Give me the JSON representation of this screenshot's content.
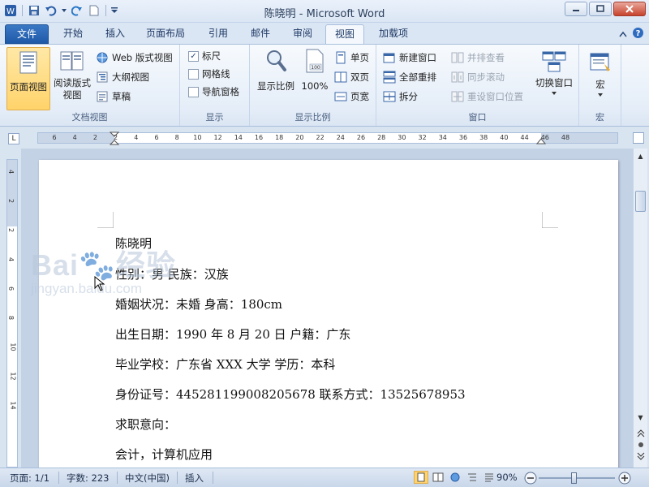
{
  "window": {
    "title": "陈晓明 - Microsoft Word",
    "app_icon": "W"
  },
  "tabs": [
    {
      "label": "文件"
    },
    {
      "label": "开始"
    },
    {
      "label": "插入"
    },
    {
      "label": "页面布局"
    },
    {
      "label": "引用"
    },
    {
      "label": "邮件"
    },
    {
      "label": "审阅"
    },
    {
      "label": "视图"
    },
    {
      "label": "加载项"
    }
  ],
  "ribbon": {
    "doc_views": {
      "label": "文档视图",
      "print_layout": "页面视图",
      "reading_layout_1": "阅读版式",
      "reading_layout_2": "视图",
      "web_layout": "Web 版式视图",
      "outline": "大纲视图",
      "draft": "草稿"
    },
    "show": {
      "label": "显示",
      "ruler": "标尺",
      "gridlines": "网格线",
      "nav_pane": "导航窗格"
    },
    "zoom": {
      "label": "显示比例",
      "zoom": "显示比例",
      "hundred": "100%",
      "one_page": "单页",
      "two_pages": "双页",
      "page_width": "页宽"
    },
    "window": {
      "label": "窗口",
      "new_window": "新建窗口",
      "arrange_all": "全部重排",
      "split": "拆分",
      "side_by_side": "并排查看",
      "sync_scroll": "同步滚动",
      "reset_position": "重设窗口位置",
      "switch_windows": "切换窗口"
    },
    "macros": {
      "label": "宏",
      "macros": "宏"
    }
  },
  "ruler": {
    "h_ticks": [
      "6",
      "4",
      "2",
      "2",
      "4",
      "6",
      "8",
      "10",
      "12",
      "14",
      "16",
      "18",
      "20",
      "22",
      "24",
      "26",
      "28",
      "30",
      "32",
      "34",
      "36",
      "38",
      "40",
      "44",
      "46",
      "48"
    ],
    "v_ticks": [
      "4",
      "2",
      "2",
      "4",
      "6",
      "8",
      "10",
      "12",
      "14"
    ]
  },
  "document": {
    "lines": [
      "陈晓明",
      "性别：男  民族：汉族",
      "婚姻状况：未婚  身高：180cm",
      "出生日期：1990 年 8 月 20 日  户籍：广东",
      "毕业学校：广东省 XXX 大学  学历：本科",
      "身份证号：445281199008205678    联系方式：13525678953",
      "求职意向：",
      "会计，计算机应用"
    ]
  },
  "watermark": {
    "brand": "Bai",
    "brand_cn": "经验",
    "url": "jingyan.baidu.com"
  },
  "status": {
    "page": "页面: 1/1",
    "words": "字数: 223",
    "language": "中文(中国)",
    "mode": "插入",
    "zoom": "90%"
  },
  "colors": {
    "accent": "#2b5797",
    "file_tab": "#2a65b4",
    "selected": "#ffd36a"
  }
}
